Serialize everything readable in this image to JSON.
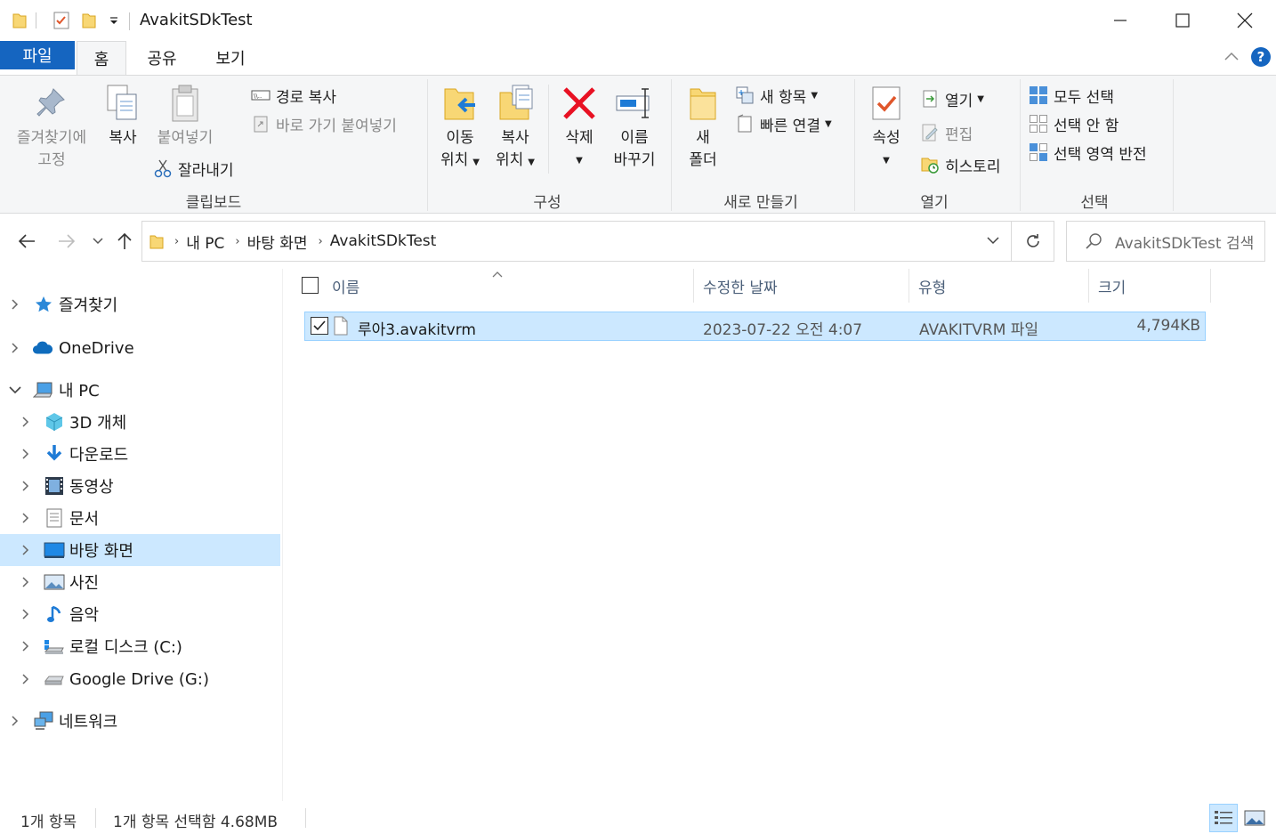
{
  "window": {
    "title": "AvakitSDkTest"
  },
  "tabs": {
    "file": "파일",
    "home": "홈",
    "share": "공유",
    "view": "보기"
  },
  "ribbon": {
    "clipboard": {
      "label": "클립보드",
      "pin_line1": "즐겨찾기에",
      "pin_line2": "고정",
      "copy": "복사",
      "paste": "붙여넣기",
      "copy_path": "경로 복사",
      "paste_shortcut": "바로 가기 붙여넣기",
      "cut": "잘라내기"
    },
    "organize": {
      "label": "구성",
      "move_line1": "이동",
      "move_line2": "위치",
      "copyto_line1": "복사",
      "copyto_line2": "위치",
      "delete": "삭제",
      "rename_line1": "이름",
      "rename_line2": "바꾸기"
    },
    "new": {
      "label": "새로 만들기",
      "new_folder_line1": "새",
      "new_folder_line2": "폴더",
      "new_item": "새 항목",
      "easy_access": "빠른 연결"
    },
    "open": {
      "label": "열기",
      "properties": "속성",
      "open": "열기",
      "edit": "편집",
      "history": "히스토리"
    },
    "select": {
      "label": "선택",
      "select_all": "모두 선택",
      "select_none": "선택 안 함",
      "invert": "선택 영역 반전"
    }
  },
  "address": {
    "crumbs": [
      "내 PC",
      "바탕 화면",
      "AvakitSDkTest"
    ],
    "search_placeholder": "AvakitSDkTest 검색"
  },
  "sidebar": {
    "items": [
      {
        "label": "즐겨찾기",
        "icon": "star-icon"
      },
      {
        "label": "OneDrive",
        "icon": "cloud-icon"
      },
      {
        "label": "내 PC",
        "icon": "computer-icon"
      },
      {
        "label": "3D 개체",
        "icon": "cube-icon"
      },
      {
        "label": "다운로드",
        "icon": "download-icon"
      },
      {
        "label": "동영상",
        "icon": "film-icon"
      },
      {
        "label": "문서",
        "icon": "document-icon"
      },
      {
        "label": "바탕 화면",
        "icon": "desktop-icon"
      },
      {
        "label": "사진",
        "icon": "picture-icon"
      },
      {
        "label": "음악",
        "icon": "music-icon"
      },
      {
        "label": "로컬 디스크 (C:)",
        "icon": "drive-icon"
      },
      {
        "label": "Google Drive (G:)",
        "icon": "drive-icon"
      },
      {
        "label": "네트워크",
        "icon": "network-icon"
      }
    ]
  },
  "columns": {
    "name": "이름",
    "modified": "수정한 날짜",
    "type": "유형",
    "size": "크기"
  },
  "files": [
    {
      "name": "루아3.avakitvrm",
      "modified": "2023-07-22 오전 4:07",
      "type": "AVAKITVRM 파일",
      "size": "4,794KB"
    }
  ],
  "status": {
    "count": "1개 항목",
    "selection": "1개 항목 선택함 4.68MB"
  },
  "colors": {
    "accent": "#1565c0",
    "selection": "#cce8ff",
    "selection_border": "#99d1ff",
    "ribbon_bg": "#f5f6f7"
  }
}
